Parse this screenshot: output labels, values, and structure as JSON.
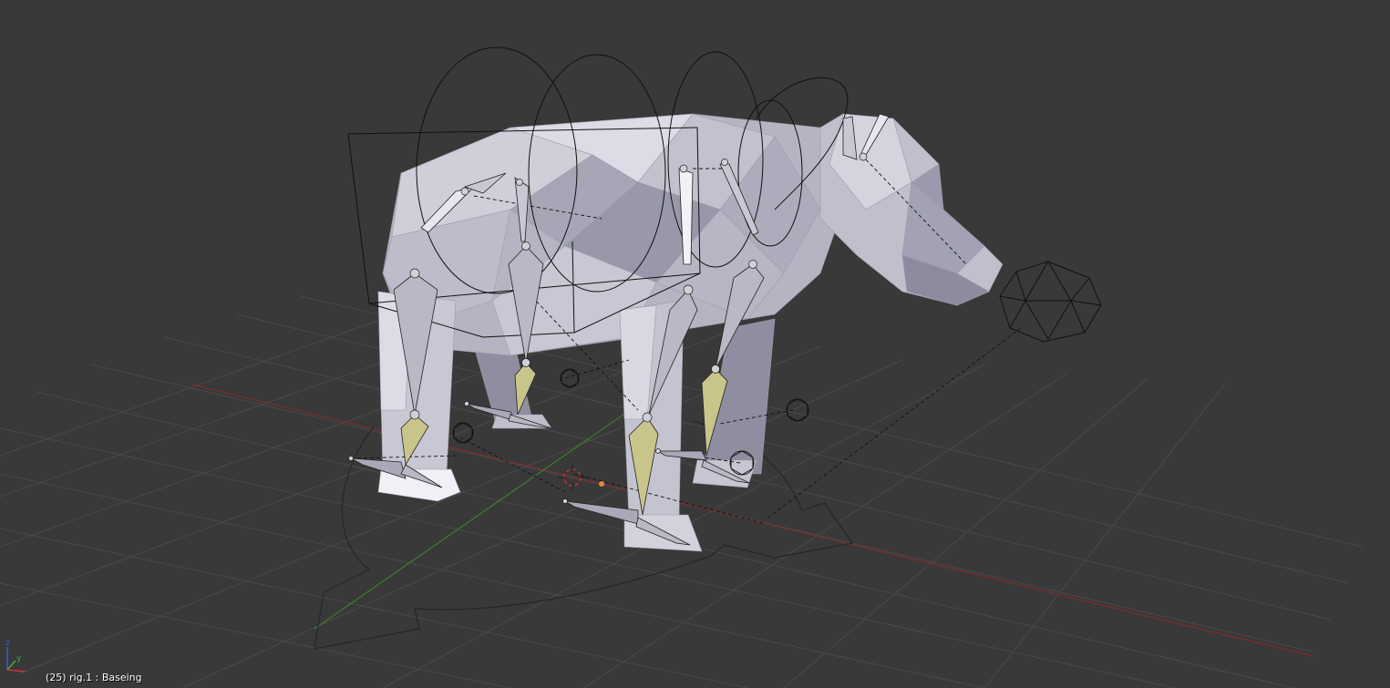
{
  "viewport": {
    "status": "(25) rig.1 : Baseing",
    "axis_labels": {
      "z": "z",
      "y": "y"
    }
  },
  "colors": {
    "background": "#393939",
    "grid": "#4a4a4a",
    "x_axis": "#8a2a2a",
    "y_axis": "#3c8a2a",
    "mesh_light": "#d2d2dc",
    "mesh_mid": "#a9a9b8",
    "mesh_dark": "#7e7e8c",
    "bone": "#b9b9c6",
    "bone_selected": "#c9c48a",
    "wire": "#111111"
  }
}
